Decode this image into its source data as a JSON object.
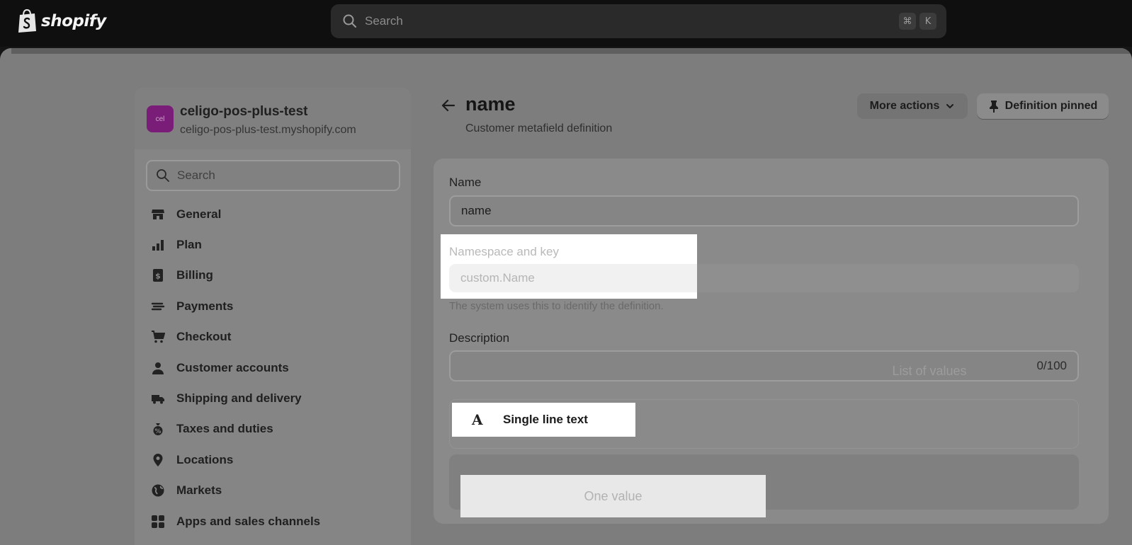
{
  "topbar": {
    "brand": "shopify",
    "search_placeholder": "Search",
    "shortcut_keys": [
      "⌘",
      "K"
    ]
  },
  "store": {
    "avatar_initials": "cel",
    "name": "celigo-pos-plus-test",
    "domain": "celigo-pos-plus-test.myshopify.com"
  },
  "sidebar": {
    "search_placeholder": "Search",
    "items": [
      {
        "label": "General",
        "icon": "store-icon"
      },
      {
        "label": "Plan",
        "icon": "plan-icon"
      },
      {
        "label": "Billing",
        "icon": "billing-icon"
      },
      {
        "label": "Payments",
        "icon": "payments-icon"
      },
      {
        "label": "Checkout",
        "icon": "cart-icon"
      },
      {
        "label": "Customer accounts",
        "icon": "person-icon"
      },
      {
        "label": "Shipping and delivery",
        "icon": "truck-icon"
      },
      {
        "label": "Taxes and duties",
        "icon": "tax-icon"
      },
      {
        "label": "Locations",
        "icon": "location-icon"
      },
      {
        "label": "Markets",
        "icon": "globe-icon"
      },
      {
        "label": "Apps and sales channels",
        "icon": "apps-icon"
      }
    ]
  },
  "page": {
    "title": "name",
    "subtitle": "Customer metafield definition",
    "more_actions_label": "More actions",
    "pinned_label": "Definition pinned"
  },
  "form": {
    "name_label": "Name",
    "name_value": "name",
    "namespace_label": "Namespace and key",
    "namespace_value": "custom.Name",
    "namespace_help": "The system uses this to identify the definition.",
    "description_label": "Description",
    "description_value": "",
    "description_counter": "0/100",
    "type_glyph": "A",
    "type_label": "Single line text",
    "one_value_label": "One value",
    "list_values_label": "List of values"
  },
  "colors": {
    "topbar": "#0f0f0f",
    "overlay": "#7d7d7d",
    "highlight": "#ffffff",
    "store_avatar": "#7a1d78"
  }
}
